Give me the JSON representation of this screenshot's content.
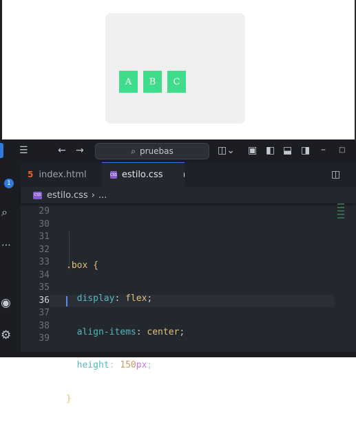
{
  "preview": {
    "boxes": [
      "A",
      "B",
      "C"
    ],
    "box_color": "#3fdc8c",
    "container_color": "#f0f0f0"
  },
  "titlebar": {
    "search_text": "pruebas",
    "icons": [
      "menu-icon",
      "back-arrow-icon",
      "forward-arrow-icon",
      "search-icon",
      "copilot-icon",
      "layout-icon",
      "sidebar-toggle-icon",
      "panel-toggle-icon",
      "secondary-sidebar-icon",
      "minimize-icon",
      "maximize-icon"
    ]
  },
  "activity": {
    "badge": "1"
  },
  "tabs": [
    {
      "label": "index.html",
      "icon": "html-icon",
      "active": false
    },
    {
      "label": "estilo.css",
      "icon": "css-icon",
      "active": true,
      "modified": true
    }
  ],
  "breadcrumb": {
    "file": "estilo.css",
    "more": "..."
  },
  "gutter": [
    "29",
    "30",
    "31",
    "32",
    "33",
    "34",
    "35",
    "36",
    "37",
    "38",
    "39"
  ],
  "code": {
    "selector": ".box",
    "open_brace": "{",
    "close_brace": "}",
    "lines": [
      {
        "prop": "display",
        "value": "flex"
      },
      {
        "prop": "align-items",
        "value": "center"
      },
      {
        "prop": "height",
        "num": "150",
        "unit": "px"
      }
    ]
  },
  "current_line": "36",
  "accent_color": "#2f7bd8"
}
